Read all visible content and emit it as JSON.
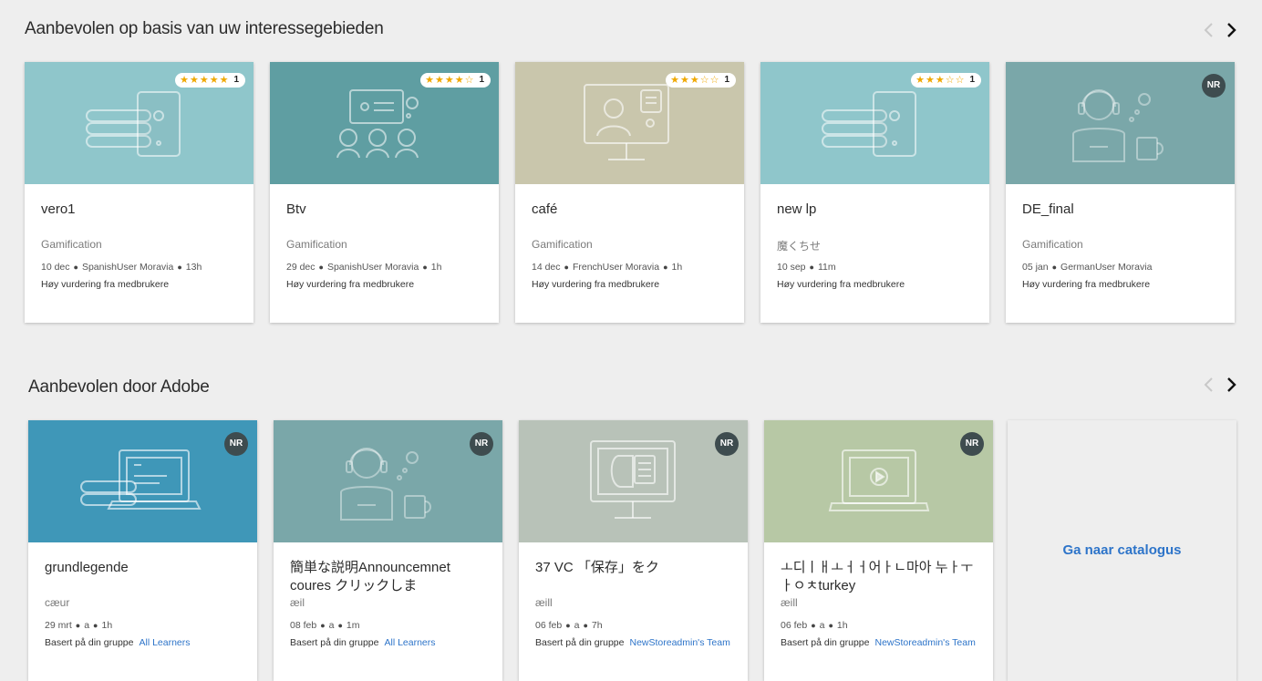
{
  "section1": {
    "title": "Aanbevolen op basis van uw interessegebieden",
    "cards": [
      {
        "title": "vero1",
        "type": "Gamification",
        "date": "10 dec",
        "author": "SpanishUser Moravia",
        "duration": "13h",
        "rec": "Høy vurdering fra medbrukere",
        "rating": 5,
        "rating_count": "1",
        "thumb_color": "#8fc6cb",
        "icon": "course-devices-icon"
      },
      {
        "title": "Btv",
        "type": "Gamification",
        "date": "29 dec",
        "author": "SpanishUser Moravia",
        "duration": "1h",
        "rec": "Høy vurdering fra medbrukere",
        "rating": 4,
        "rating_count": "1",
        "thumb_color": "#5f9ea2",
        "icon": "presentation-icon"
      },
      {
        "title": "café",
        "type": "Gamification",
        "date": "14 dec",
        "author": "FrenchUser Moravia",
        "duration": "1h",
        "rec": "Høy vurdering fra medbrukere",
        "rating": 3,
        "rating_count": "1",
        "thumb_color": "#c9c6ac",
        "icon": "monitor-user-icon"
      },
      {
        "title": "new lp",
        "type": "魔くちせ",
        "date": "10 sep",
        "author": "",
        "duration": "11m",
        "rec": "Høy vurdering fra medbrukere",
        "rating": 3,
        "rating_count": "1",
        "thumb_color": "#8fc6cb",
        "icon": "course-devices-icon"
      },
      {
        "title": "DE_final",
        "type": "Gamification",
        "date": "05 jan",
        "author": "GermanUser Moravia",
        "duration": "",
        "rec": "Høy vurdering fra medbrukere",
        "badge": "NR",
        "thumb_color": "#7aa7a9",
        "icon": "headset-user-icon"
      }
    ]
  },
  "section2": {
    "title": "Aanbevolen door Adobe",
    "cards": [
      {
        "title": "grundlegende",
        "type": "cæur",
        "date": "29 mrt",
        "author": "a",
        "duration": "1h",
        "rec": "Basert på din gruppe",
        "rec_link": "All Learners",
        "badge": "NR",
        "thumb_color": "#3f97b8",
        "icon": "laptop-books-icon"
      },
      {
        "title": "簡単な説明Announcemnet coures クリックしま",
        "type": "æil",
        "date": "08 feb",
        "author": "a",
        "duration": "1m",
        "rec": "Basert på din gruppe",
        "rec_link": "All Learners",
        "badge": "NR",
        "thumb_color": "#7aa7a9",
        "icon": "headset-user-icon"
      },
      {
        "title": "37 VC 「保存」をク",
        "type": "æill",
        "date": "06 feb",
        "author": "a",
        "duration": "7h",
        "rec": "Basert på din gruppe",
        "rec_link": "NewStoreadmin's Team",
        "badge": "NR",
        "thumb_color": "#b8c2b8",
        "icon": "monitor-brain-icon"
      },
      {
        "title": "ㅗ디ㅣㅐㅗㅓㅓ어ㅏㄴ마아 누ㅏㅜㅏㅇㅊturkey",
        "type": "æill",
        "date": "06 feb",
        "author": "a",
        "duration": "1h",
        "rec": "Basert på din gruppe",
        "rec_link": "NewStoreadmin's Team",
        "badge": "NR",
        "thumb_color": "#b7c8a5",
        "icon": "laptop-video-icon"
      }
    ],
    "catalog_link": "Ga naar catalogus"
  },
  "colors": {
    "accent": "#2d74c9",
    "badge": "#3e4c4f",
    "star": "#f0a800",
    "page_bg": "#eeeeee"
  },
  "icons": {
    "prev": "chevron-left-icon",
    "next": "chevron-right-icon",
    "star": "star-icon"
  }
}
